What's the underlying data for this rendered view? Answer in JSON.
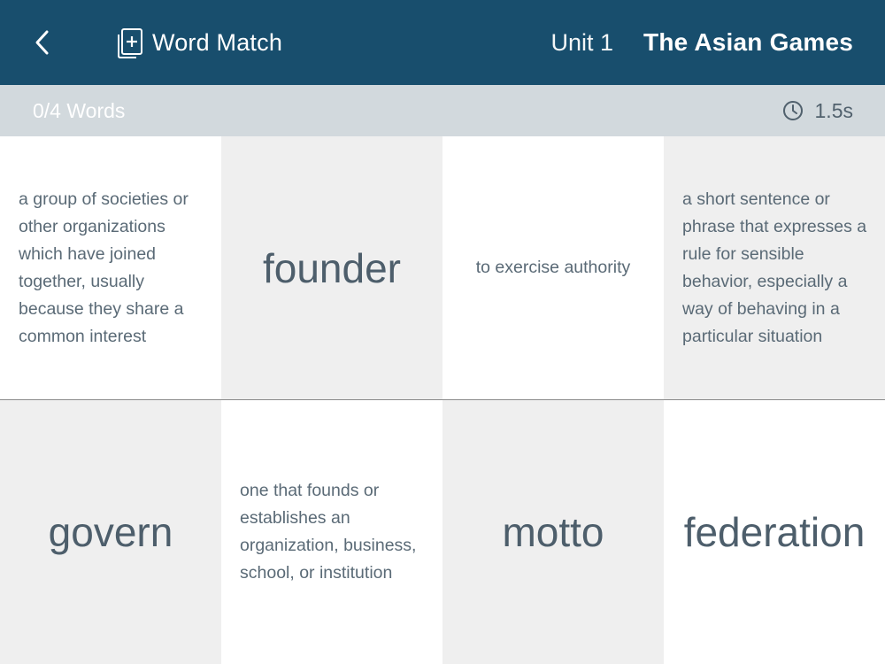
{
  "header": {
    "app_title": "Word Match",
    "unit": "Unit 1",
    "lesson": "The Asian Games",
    "background_color": "#184e6d",
    "icons": {
      "back": "chevron-left-icon",
      "app": "flashcard-add-icon"
    }
  },
  "status": {
    "progress": "0/4 Words",
    "timer": "1.5s",
    "timer_icon": "clock-icon"
  },
  "tiles": [
    {
      "text": "a group of societies or other organizations which have joined together, usually because they share a common interest"
    },
    {
      "text": "founder"
    },
    {
      "text": "to exercise authority"
    },
    {
      "text": "a short sentence or phrase that expresses a rule for sensible behavior, especially a way of behaving in a particular situation"
    },
    {
      "text": "govern"
    },
    {
      "text": "one that founds or establishes an organization, business, school, or institution"
    },
    {
      "text": "motto"
    },
    {
      "text": "federation"
    }
  ]
}
